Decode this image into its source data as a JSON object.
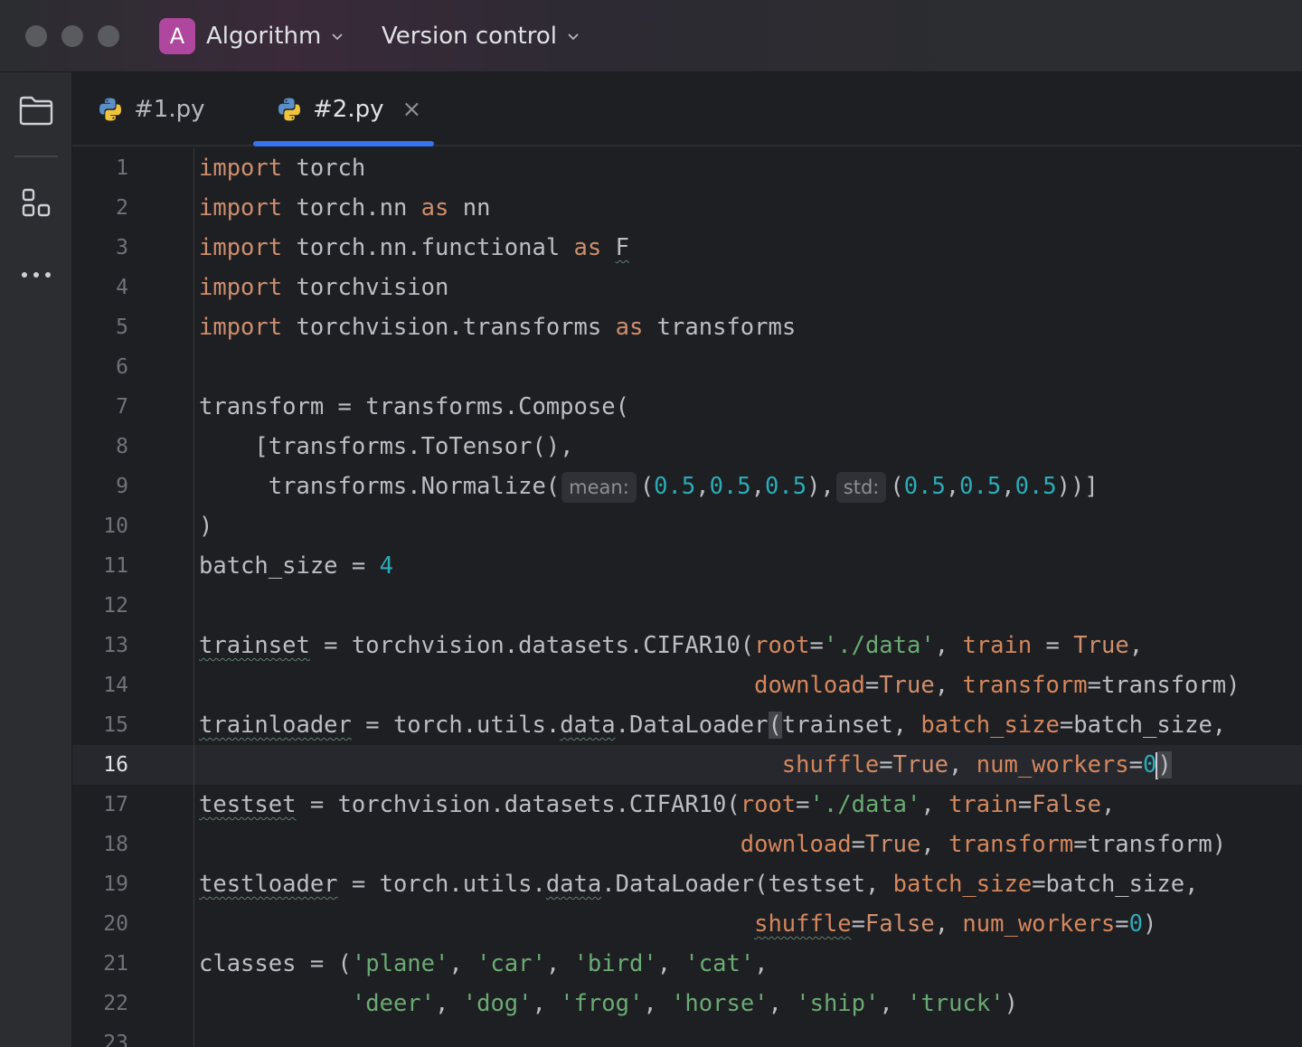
{
  "window": {
    "project_initial": "A",
    "project_name": "Algorithm",
    "vcs_label": "Version control"
  },
  "colors": {
    "accent": "#3574f0",
    "project_badge": "#b0479e",
    "keyword": "#cf8e6d",
    "number": "#2aacb8",
    "string": "#6aab73",
    "param": "#d5875c"
  },
  "sidebar": {
    "icons": [
      "folder-icon",
      "structure-icon",
      "more-icon"
    ]
  },
  "tabs": [
    {
      "label": "#1.py",
      "icon": "python-icon",
      "active": false
    },
    {
      "label": "#2.py",
      "icon": "python-icon",
      "active": true,
      "close": "×"
    }
  ],
  "editor": {
    "current_line": 16,
    "line_numbers": [
      "1",
      "2",
      "3",
      "4",
      "5",
      "6",
      "7",
      "8",
      "9",
      "10",
      "11",
      "12",
      "13",
      "14",
      "15",
      "16",
      "17",
      "18",
      "19",
      "20",
      "21",
      "22",
      "23"
    ],
    "hints": {
      "mean": "mean:",
      "std": "std:"
    }
  }
}
